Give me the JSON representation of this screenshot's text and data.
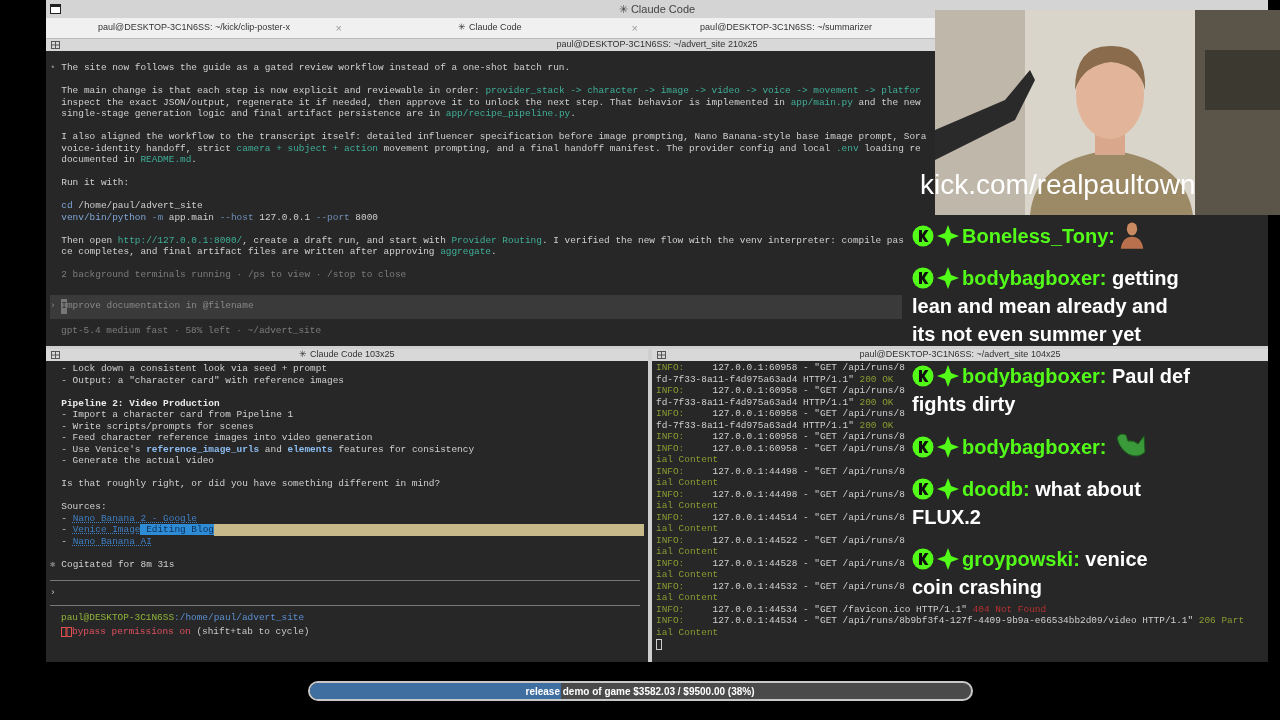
{
  "window": {
    "title": "✳ Claude Code"
  },
  "tabs": [
    {
      "label": "paul@DESKTOP-3C1N6SS: ~/kick/clip-poster-x",
      "close": "×"
    },
    {
      "label": "✳ Claude Code",
      "close": "×"
    },
    {
      "label": "paul@DESKTOP-3C1N6SS: ~/summarizer"
    }
  ],
  "top_pane": {
    "title": "paul@DESKTOP-3C1N6SS: ~/advert_site 210x25",
    "lines": [
      {
        "kind": "text",
        "segments": [
          {
            "text": "•",
            "kind": "dim"
          },
          {
            "text": " The site now follows the guide as a gated review workflow instead of a one-shot batch run.",
            "kind": "plain"
          }
        ]
      },
      {
        "kind": "blank"
      },
      {
        "kind": "text",
        "segments": [
          {
            "text": "  The main change is that each step is now explicit and reviewable in order: ",
            "kind": "plain"
          },
          {
            "text": "provider_stack -> character -> image -> video -> voice -> movement -> platfor",
            "kind": "accent"
          }
        ]
      },
      {
        "kind": "text",
        "segments": [
          {
            "text": "  inspect the exact JSON/output, regenerate it if needed, then approve it to unlock the next step. That behavior is implemented in ",
            "kind": "plain"
          },
          {
            "text": "app/main.py",
            "kind": "accent"
          },
          {
            "text": " and the new",
            "kind": "plain"
          }
        ]
      },
      {
        "kind": "text",
        "segments": [
          {
            "text": "  single-stage generation logic and final artifact persistence are in ",
            "kind": "plain"
          },
          {
            "text": "app/recipe_pipeline.py",
            "kind": "accent"
          },
          {
            "text": ".",
            "kind": "plain"
          }
        ]
      },
      {
        "kind": "blank"
      },
      {
        "kind": "text",
        "segments": [
          {
            "text": "  I also aligned the workflow to the transcript itself: detailed influencer specification before image prompting, Nano Banana-style base image prompt, Sora",
            "kind": "plain"
          }
        ]
      },
      {
        "kind": "text",
        "segments": [
          {
            "text": "  voice-identity handoff, strict ",
            "kind": "plain"
          },
          {
            "text": "camera + subject + action",
            "kind": "accent"
          },
          {
            "text": " movement prompting, and a final handoff manifest. The provider config and local ",
            "kind": "plain"
          },
          {
            "text": ".env",
            "kind": "accent"
          },
          {
            "text": " loading re",
            "kind": "plain"
          }
        ]
      },
      {
        "kind": "text",
        "segments": [
          {
            "text": "  documented in ",
            "kind": "plain"
          },
          {
            "text": "README.md",
            "kind": "accent"
          },
          {
            "text": ".",
            "kind": "plain"
          }
        ]
      },
      {
        "kind": "blank"
      },
      {
        "kind": "text",
        "segments": [
          {
            "text": "  Run it with:",
            "kind": "plain"
          }
        ]
      },
      {
        "kind": "blank"
      },
      {
        "kind": "text",
        "segments": [
          {
            "text": "  cd",
            "kind": "command"
          },
          {
            "text": " /home/paul/advert_site",
            "kind": "plain"
          }
        ]
      },
      {
        "kind": "text",
        "segments": [
          {
            "text": "  venv/bin/python",
            "kind": "command"
          },
          {
            "text": " -m",
            "kind": "flag"
          },
          {
            "text": " app.main",
            "kind": "plain"
          },
          {
            "text": " --host",
            "kind": "flag"
          },
          {
            "text": " 127.0.0.1",
            "kind": "plain"
          },
          {
            "text": " --port",
            "kind": "flag"
          },
          {
            "text": " 8000",
            "kind": "plain"
          }
        ]
      },
      {
        "kind": "blank"
      },
      {
        "kind": "text",
        "segments": [
          {
            "text": "  Then open ",
            "kind": "plain"
          },
          {
            "text": "http://127.0.0.1:8000/",
            "kind": "accent"
          },
          {
            "text": ", create a draft run, and start with ",
            "kind": "plain"
          },
          {
            "text": "Provider Routing",
            "kind": "accent"
          },
          {
            "text": ". I verified the new flow with the venv interpreter: compile pas",
            "kind": "plain"
          }
        ]
      },
      {
        "kind": "text",
        "segments": [
          {
            "text": "  ce completes, and final artifact files are written after approving ",
            "kind": "plain"
          },
          {
            "text": "aggregate",
            "kind": "accent"
          },
          {
            "text": ".",
            "kind": "plain"
          }
        ]
      },
      {
        "kind": "blank"
      },
      {
        "kind": "text",
        "segments": [
          {
            "text": "  2 background terminals running · /ps to view · /stop to close",
            "kind": "dim"
          }
        ]
      }
    ],
    "prompt_symbol": "›",
    "input_placeholder": "Improve documentation in @filename",
    "status": "gpt-5.4 medium fast · 58% left · ~/advert_site"
  },
  "left_pane": {
    "title": "✳ Claude Code 103x25",
    "lines": [
      {
        "kind": "text",
        "segments": [
          {
            "text": "  - Lock down a consistent look via seed + prompt",
            "kind": "plain"
          }
        ]
      },
      {
        "kind": "text",
        "segments": [
          {
            "text": "  - Output: a \"character card\" with reference images",
            "kind": "plain"
          }
        ]
      },
      {
        "kind": "blank"
      },
      {
        "kind": "text",
        "segments": [
          {
            "text": "  Pipeline 2: Video Production",
            "kind": "bold"
          }
        ]
      },
      {
        "kind": "text",
        "segments": [
          {
            "text": "  - Import a character card from Pipeline 1",
            "kind": "plain"
          }
        ]
      },
      {
        "kind": "text",
        "segments": [
          {
            "text": "  - Write scripts/prompts for scenes",
            "kind": "plain"
          }
        ]
      },
      {
        "kind": "text",
        "segments": [
          {
            "text": "  - Feed character reference images into video generation",
            "kind": "plain"
          }
        ]
      },
      {
        "kind": "text",
        "segments": [
          {
            "text": "  - Use Venice's ",
            "kind": "plain"
          },
          {
            "text": "reference_image_urls",
            "kind": "code"
          },
          {
            "text": " and ",
            "kind": "plain"
          },
          {
            "text": "elements",
            "kind": "code"
          },
          {
            "text": " features for consistency",
            "kind": "plain"
          }
        ]
      },
      {
        "kind": "text",
        "segments": [
          {
            "text": "  - Generate the actual video",
            "kind": "plain"
          }
        ]
      },
      {
        "kind": "blank"
      },
      {
        "kind": "text",
        "segments": [
          {
            "text": "  Is that roughly right, or did you have something different in mind?",
            "kind": "plain"
          }
        ]
      },
      {
        "kind": "blank"
      },
      {
        "kind": "text",
        "segments": [
          {
            "text": "  Sources:",
            "kind": "plain"
          }
        ]
      },
      {
        "kind": "text",
        "segments": [
          {
            "text": "  - ",
            "kind": "plain"
          },
          {
            "text": "Nano Banana 2 - Google",
            "kind": "link"
          }
        ]
      },
      {
        "kind": "text",
        "highlighted": true,
        "segments": [
          {
            "text": "  - ",
            "kind": "plain"
          },
          {
            "text": "Venice Image",
            "kind": "link"
          },
          {
            "text": " Editing Blog",
            "kind": "selection"
          }
        ]
      },
      {
        "kind": "text",
        "segments": [
          {
            "text": "  - ",
            "kind": "plain"
          },
          {
            "text": "Nano Banana AI",
            "kind": "link"
          }
        ]
      },
      {
        "kind": "blank"
      },
      {
        "kind": "text",
        "segments": [
          {
            "text": "✱",
            "kind": "dim"
          },
          {
            "text": " Cogitated for 8m 31s",
            "kind": "plain"
          }
        ]
      }
    ],
    "prompt_symbol": "›",
    "shell_user": "paul@DESKTOP-3C1N6SS",
    "shell_path": ":/home/paul/advert_site",
    "mode_text": "bypass permissions on",
    "mode_hint": " (shift+tab to cycle)"
  },
  "right_pane": {
    "title": "paul@DESKTOP-3C1N6SS: ~/advert_site 104x25",
    "lines": [
      {
        "kind": "text",
        "segments": [
          {
            "text": "INFO:",
            "kind": "info"
          },
          {
            "text": "     127.0.0.1:60958 - \"GET /api/runs/8",
            "kind": "plain"
          }
        ]
      },
      {
        "kind": "text",
        "segments": [
          {
            "text": "fd-7f33-8a11-f4d975a63ad4 HTTP/1.1\" ",
            "kind": "plain"
          },
          {
            "text": "200 OK",
            "kind": "info"
          }
        ]
      },
      {
        "kind": "text",
        "segments": [
          {
            "text": "INFO:",
            "kind": "info"
          },
          {
            "text": "     127.0.0.1:60958 - \"GET /api/runs/8",
            "kind": "plain"
          }
        ]
      },
      {
        "kind": "text",
        "segments": [
          {
            "text": "fd-7f33-8a11-f4d975a63ad4 HTTP/1.1\" ",
            "kind": "plain"
          },
          {
            "text": "200 OK",
            "kind": "info"
          }
        ]
      },
      {
        "kind": "text",
        "segments": [
          {
            "text": "INFO:",
            "kind": "info"
          },
          {
            "text": "     127.0.0.1:60958 - \"GET /api/runs/8",
            "kind": "plain"
          }
        ]
      },
      {
        "kind": "text",
        "segments": [
          {
            "text": "fd-7f33-8a11-f4d975a63ad4 HTTP/1.1\" ",
            "kind": "plain"
          },
          {
            "text": "200 OK",
            "kind": "info"
          }
        ]
      },
      {
        "kind": "text",
        "segments": [
          {
            "text": "INFO:",
            "kind": "info"
          },
          {
            "text": "     127.0.0.1:60958 - \"GET /api/runs/8",
            "kind": "plain"
          }
        ]
      },
      {
        "kind": "text",
        "segments": [
          {
            "text": "INFO:",
            "kind": "info"
          },
          {
            "text": "     127.0.0.1:60958 - \"GET /api/runs/8",
            "kind": "plain"
          }
        ]
      },
      {
        "kind": "text",
        "segments": [
          {
            "text": "ial Content",
            "kind": "info"
          }
        ]
      },
      {
        "kind": "text",
        "segments": [
          {
            "text": "INFO:",
            "kind": "info"
          },
          {
            "text": "     127.0.0.1:44498 - \"GET /api/runs/8",
            "kind": "plain"
          }
        ]
      },
      {
        "kind": "text",
        "segments": [
          {
            "text": "ial Content",
            "kind": "info"
          }
        ]
      },
      {
        "kind": "text",
        "segments": [
          {
            "text": "INFO:",
            "kind": "info"
          },
          {
            "text": "     127.0.0.1:44498 - \"GET /api/runs/8",
            "kind": "plain"
          }
        ]
      },
      {
        "kind": "text",
        "segments": [
          {
            "text": "ial Content",
            "kind": "info"
          }
        ]
      },
      {
        "kind": "text",
        "segments": [
          {
            "text": "INFO:",
            "kind": "info"
          },
          {
            "text": "     127.0.0.1:44514 - \"GET /api/runs/8",
            "kind": "plain"
          }
        ]
      },
      {
        "kind": "text",
        "segments": [
          {
            "text": "ial Content",
            "kind": "info"
          }
        ]
      },
      {
        "kind": "text",
        "segments": [
          {
            "text": "INFO:",
            "kind": "info"
          },
          {
            "text": "     127.0.0.1:44522 - \"GET /api/runs/8",
            "kind": "plain"
          }
        ]
      },
      {
        "kind": "text",
        "segments": [
          {
            "text": "ial Content",
            "kind": "info"
          }
        ]
      },
      {
        "kind": "text",
        "segments": [
          {
            "text": "INFO:",
            "kind": "info"
          },
          {
            "text": "     127.0.0.1:44528 - \"GET /api/runs/8",
            "kind": "plain"
          }
        ]
      },
      {
        "kind": "text",
        "segments": [
          {
            "text": "ial Content",
            "kind": "info"
          }
        ]
      },
      {
        "kind": "text",
        "segments": [
          {
            "text": "INFO:",
            "kind": "info"
          },
          {
            "text": "     127.0.0.1:44532 - \"GET /api/runs/8",
            "kind": "plain"
          }
        ]
      },
      {
        "kind": "text",
        "segments": [
          {
            "text": "ial Content",
            "kind": "info"
          }
        ]
      },
      {
        "kind": "text",
        "segments": [
          {
            "text": "INFO:",
            "kind": "info"
          },
          {
            "text": "     127.0.0.1:44534 - \"GET /favicon.ico HTTP/1.1\" ",
            "kind": "plain"
          },
          {
            "text": "404 Not Found",
            "kind": "error"
          }
        ]
      },
      {
        "kind": "text",
        "segments": [
          {
            "text": "INFO:",
            "kind": "info"
          },
          {
            "text": "     127.0.0.1:44534 - \"GET /api/runs/8b9bf3f4-127f-4409-9b9a-e66534bb2d09/video HTTP/1.1\" ",
            "kind": "plain"
          },
          {
            "text": "206 Part",
            "kind": "info"
          }
        ]
      },
      {
        "kind": "text",
        "segments": [
          {
            "text": "ial Content",
            "kind": "info"
          }
        ]
      }
    ]
  },
  "stream_overlay": {
    "channel_url": "kick.com/realpaultown",
    "messages": [
      {
        "user": "Boneless_Tony:",
        "kind": "figure"
      },
      {
        "user": "bodybagboxer:",
        "kind": "text",
        "text": "getting lean and mean already and its not even summer yet"
      },
      {
        "user": "bodybagboxer:",
        "kind": "text",
        "text": "Paul def fights dirty"
      },
      {
        "user": "bodybagboxer:",
        "kind": "arm"
      },
      {
        "user": "doodb:",
        "kind": "text",
        "text": "what about FLUX.2"
      },
      {
        "user": "groypowski:",
        "kind": "text",
        "text": "venice coin crashing"
      }
    ]
  },
  "goal": {
    "label": "release demo of game $3582.03 / $9500.00 (38%)",
    "level": 0.38
  }
}
